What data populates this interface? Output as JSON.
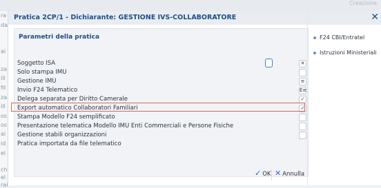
{
  "dialog": {
    "title": "Pratica 2CP/1 - Dichiarante: GESTIONE IVS-COLLABORATORE",
    "close_glyph": "✕"
  },
  "panel": {
    "title": "Parametri della pratica",
    "rows": [
      {
        "label": "Soggetto ISA",
        "mark": "✕"
      },
      {
        "label": "Solo stampa IMU",
        "mark": ""
      },
      {
        "label": "Gestione IMU",
        "mark": "≡"
      },
      {
        "label": "Invio F24 Telematico",
        "mark": "E≡"
      },
      {
        "label": "Delega separata per Diritto Camerale",
        "mark": "✓"
      },
      {
        "label": "Export automatico Collaboratori Familiari",
        "mark": "✓"
      },
      {
        "label": "Stampa Modello F24 semplificato",
        "mark": ""
      },
      {
        "label": "Presentazione telematica Modello IMU Enti Commerciali e Persone Fisiche",
        "mark": ""
      },
      {
        "label": "Gestione stabili organizzazioni",
        "mark": ""
      },
      {
        "label": "Pratica importata da file telematico",
        "mark": ""
      }
    ]
  },
  "actions": {
    "f24": "F24 CBI/Entratel",
    "istruzioni": "Istruzioni Ministeriali"
  },
  "buttons": {
    "ok": "OK",
    "ok_icon": "✓",
    "annulla": "Annulla",
    "annulla_icon": "✕"
  },
  "background": {
    "top_right": "Creazione",
    "left_letters": [
      "ra",
      "da",
      "ai",
      "za",
      "ill",
      "fil",
      "za",
      "ill",
      "os",
      "os",
      "ai",
      "id",
      "ei",
      "ch",
      "ei",
      "rai"
    ]
  },
  "colors": {
    "accent": "#1f4e87",
    "highlight_border": "#e0615a",
    "isa_focus": "#3b7fd0"
  }
}
